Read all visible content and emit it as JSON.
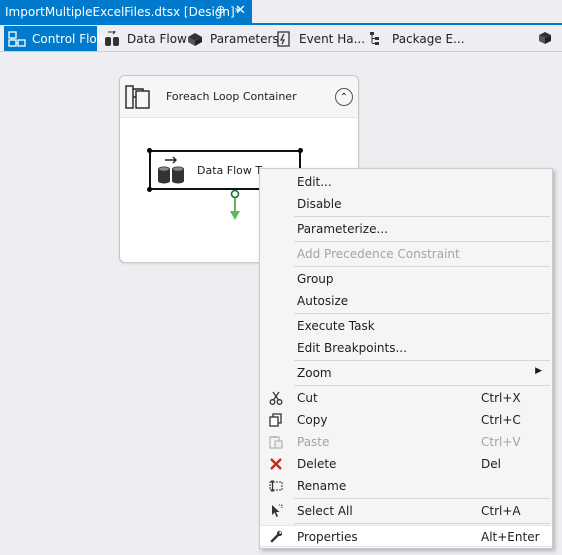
{
  "document_tab": {
    "title": "ImportMultipleExcelFiles.dtsx [Design]*",
    "pin_glyph": "⊕",
    "close_glyph": "✕"
  },
  "designer_tabs": [
    {
      "label": "Control Flow",
      "icon": "control-flow-icon",
      "active": true
    },
    {
      "label": "Data Flow",
      "icon": "data-flow-icon",
      "active": false
    },
    {
      "label": "Parameters",
      "icon": "parameters-icon",
      "active": false
    },
    {
      "label": "Event Ha...",
      "icon": "event-handlers-icon",
      "active": false
    },
    {
      "label": "Package E...",
      "icon": "package-explorer-icon",
      "active": false
    }
  ],
  "canvas": {
    "container": {
      "title": "Foreach Loop Container",
      "collapse_glyph": "⌃"
    },
    "task": {
      "label": "Data Flow Ta"
    }
  },
  "context_menu": {
    "items": [
      {
        "label": "Edit...",
        "shortcut": "",
        "icon": "",
        "disabled": false
      },
      {
        "label": "Disable",
        "shortcut": "",
        "icon": "",
        "disabled": false
      },
      {
        "label": "Parameterize...",
        "shortcut": "",
        "icon": "",
        "disabled": false
      },
      {
        "label": "Add Precedence Constraint",
        "shortcut": "",
        "icon": "",
        "disabled": true
      },
      {
        "label": "Group",
        "shortcut": "",
        "icon": "",
        "disabled": false
      },
      {
        "label": "Autosize",
        "shortcut": "",
        "icon": "",
        "disabled": false
      },
      {
        "label": "Execute Task",
        "shortcut": "",
        "icon": "",
        "disabled": false
      },
      {
        "label": "Edit Breakpoints...",
        "shortcut": "",
        "icon": "",
        "disabled": false
      },
      {
        "label": "Zoom",
        "shortcut": "",
        "icon": "",
        "disabled": false,
        "submenu": true
      },
      {
        "label": "Cut",
        "shortcut": "Ctrl+X",
        "icon": "scissors-icon",
        "disabled": false
      },
      {
        "label": "Copy",
        "shortcut": "Ctrl+C",
        "icon": "copy-icon",
        "disabled": false
      },
      {
        "label": "Paste",
        "shortcut": "Ctrl+V",
        "icon": "paste-icon",
        "disabled": true
      },
      {
        "label": "Delete",
        "shortcut": "Del",
        "icon": "delete-x-icon",
        "disabled": false
      },
      {
        "label": "Rename",
        "shortcut": "",
        "icon": "rename-icon",
        "disabled": false
      },
      {
        "label": "Select All",
        "shortcut": "Ctrl+A",
        "icon": "select-all-icon",
        "disabled": false
      },
      {
        "label": "Properties",
        "shortcut": "Alt+Enter",
        "icon": "wrench-icon",
        "disabled": false,
        "highlighted": true
      }
    ],
    "submenu_arrow": "▶"
  },
  "colors": {
    "accent": "#007acc",
    "canvas_bg": "#eeeef2",
    "delete_red": "#c42b1c",
    "precedence_green": "#5cb85c"
  }
}
